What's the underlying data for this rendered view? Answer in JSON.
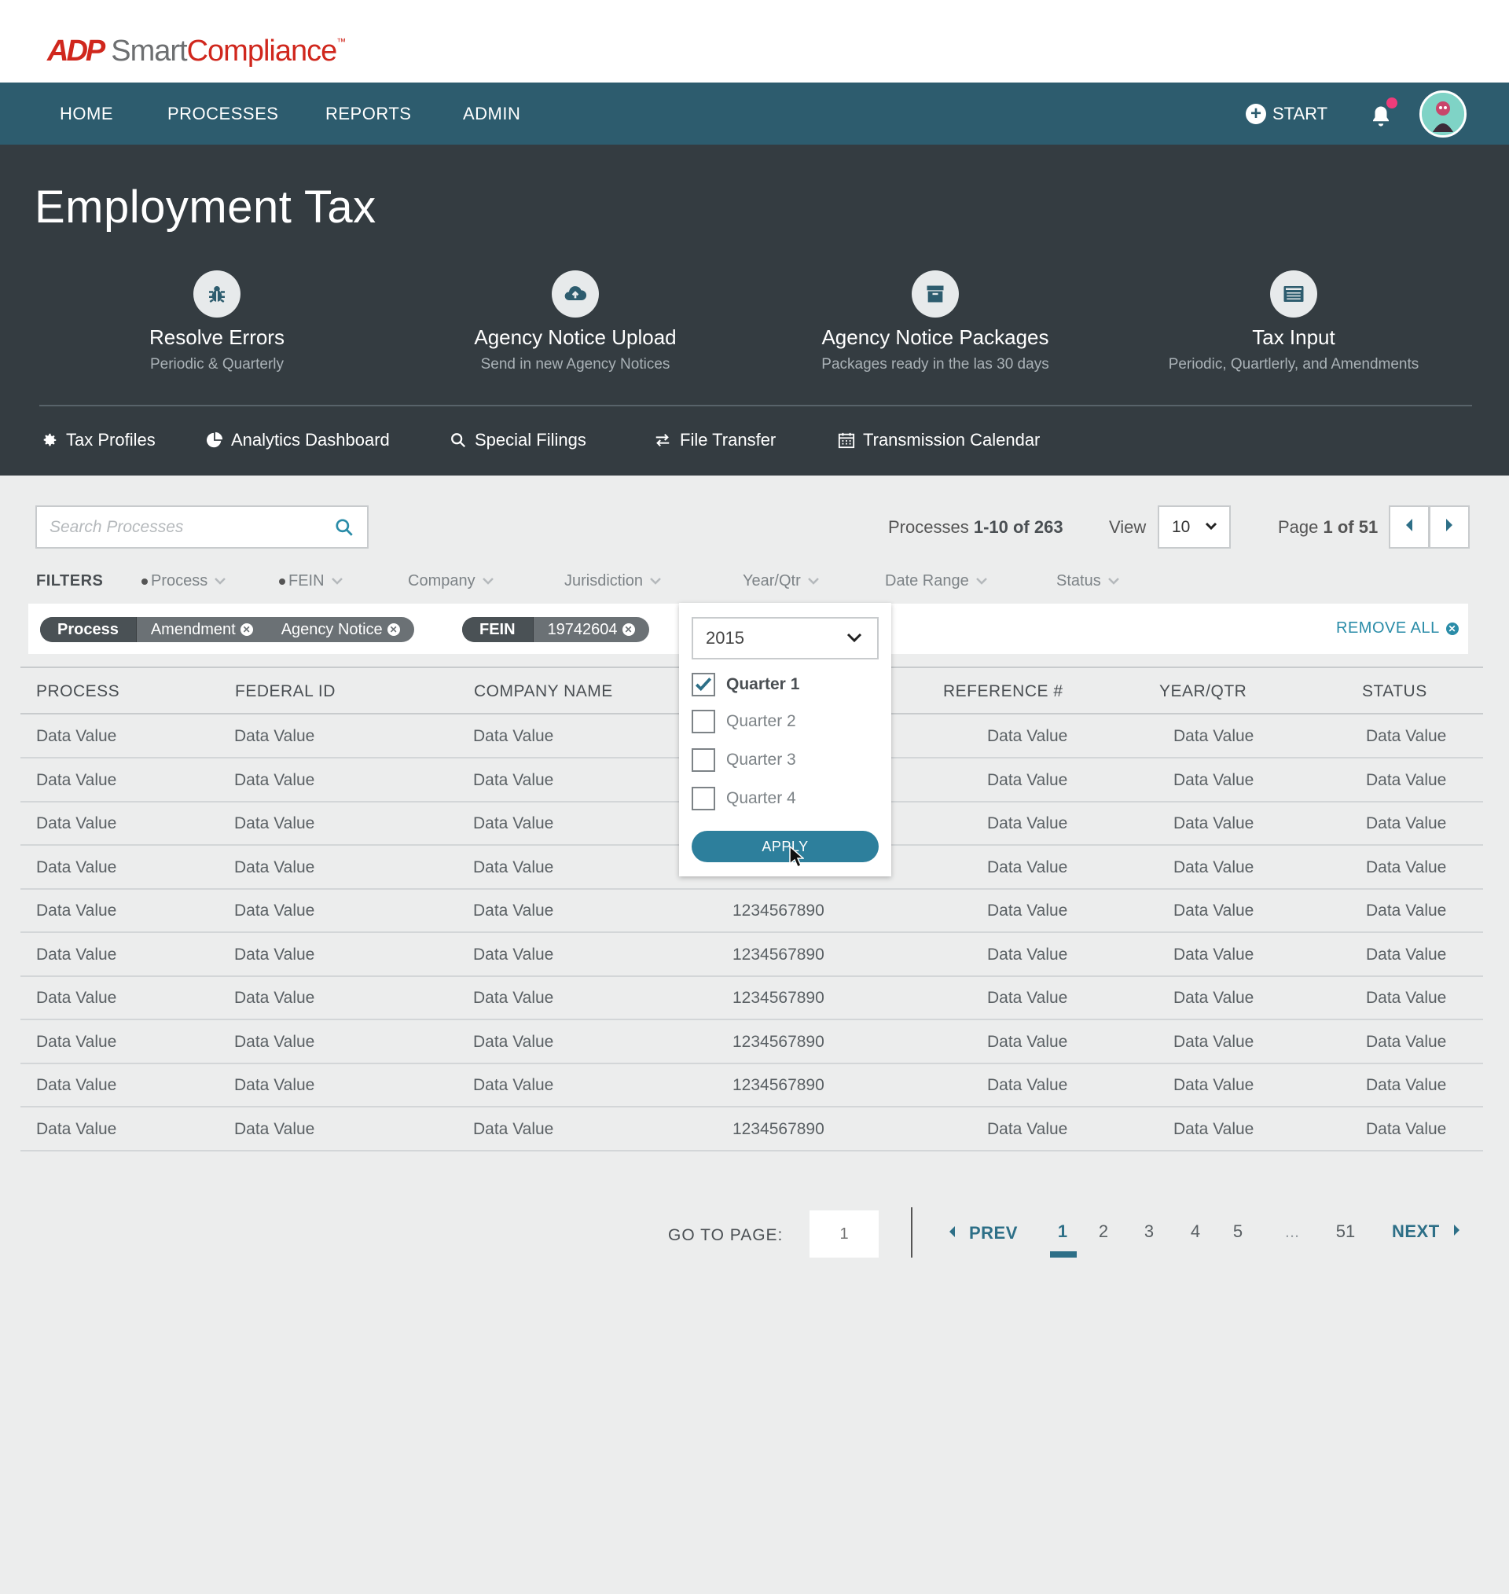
{
  "logo": {
    "mark": "ADP",
    "smart": "Smart",
    "compliance": "Compliance",
    "tm": "™"
  },
  "nav": {
    "items": [
      "HOME",
      "PROCESSES",
      "REPORTS",
      "ADMIN"
    ],
    "start_label": "START"
  },
  "hero": {
    "title": "Employment Tax",
    "tiles": [
      {
        "icon": "bug-icon",
        "title": "Resolve Errors",
        "subtitle": "Periodic & Quarterly"
      },
      {
        "icon": "cloud-upload-icon",
        "title": "Agency Notice Upload",
        "subtitle": "Send in new Agency Notices"
      },
      {
        "icon": "archive-box-icon",
        "title": "Agency Notice Packages",
        "subtitle": "Packages ready in the las 30 days"
      },
      {
        "icon": "list-card-icon",
        "title": "Tax Input",
        "subtitle": "Periodic, Quartlerly, and Amendments"
      }
    ],
    "links": [
      {
        "icon": "gear-icon",
        "label": "Tax Profiles"
      },
      {
        "icon": "pie-chart-icon",
        "label": "Analytics Dashboard"
      },
      {
        "icon": "search-icon",
        "label": "Special Filings"
      },
      {
        "icon": "transfer-arrows-icon",
        "label": "File Transfer"
      },
      {
        "icon": "calendar-icon",
        "label": "Transmission Calendar"
      }
    ]
  },
  "toolbar": {
    "search_placeholder": "Search Processes",
    "count_prefix": "Processes ",
    "count_range": "1-10 of 263",
    "view_label": "View",
    "view_value": "10",
    "page_prefix": "Page ",
    "page_value": "1 of 51"
  },
  "filters": {
    "label": "FILTERS",
    "items": [
      "Process",
      "FEIN",
      "Company",
      "Jurisdiction",
      "Year/Qtr",
      "Date Range",
      "Status"
    ]
  },
  "chips": {
    "groups": [
      {
        "head": "Process",
        "values": [
          "Amendment",
          "Agency Notice"
        ]
      },
      {
        "head": "FEIN",
        "values": [
          "19742604"
        ]
      }
    ],
    "remove_all": "REMOVE ALL"
  },
  "table": {
    "headers": [
      "PROCESS",
      "FEDERAL ID",
      "COMPANY NAME",
      "REFERENCE #",
      "YEAR/QTR",
      "STATUS"
    ],
    "rows": [
      [
        "Data Value",
        "Data Value",
        "Data Value",
        "",
        "Data Value",
        "Data Value",
        "Data Value"
      ],
      [
        "Data Value",
        "Data Value",
        "Data Value",
        "",
        "Data Value",
        "Data Value",
        "Data Value"
      ],
      [
        "Data Value",
        "Data Value",
        "Data Value",
        "",
        "Data Value",
        "Data Value",
        "Data Value"
      ],
      [
        "Data Value",
        "Data Value",
        "Data Value",
        "",
        "Data Value",
        "Data Value",
        "Data Value"
      ],
      [
        "Data Value",
        "Data Value",
        "Data Value",
        "1234567890",
        "Data Value",
        "Data Value",
        "Data Value"
      ],
      [
        "Data Value",
        "Data Value",
        "Data Value",
        "1234567890",
        "Data Value",
        "Data Value",
        "Data Value"
      ],
      [
        "Data Value",
        "Data Value",
        "Data Value",
        "1234567890",
        "Data Value",
        "Data Value",
        "Data Value"
      ],
      [
        "Data Value",
        "Data Value",
        "Data Value",
        "1234567890",
        "Data Value",
        "Data Value",
        "Data Value"
      ],
      [
        "Data Value",
        "Data Value",
        "Data Value",
        "1234567890",
        "Data Value",
        "Data Value",
        "Data Value"
      ],
      [
        "Data Value",
        "Data Value",
        "Data Value",
        "1234567890",
        "Data Value",
        "Data Value",
        "Data Value"
      ]
    ]
  },
  "dropdown": {
    "year": "2015",
    "quarters": [
      {
        "label": "Quarter 1",
        "checked": true
      },
      {
        "label": "Quarter 2",
        "checked": false
      },
      {
        "label": "Quarter 3",
        "checked": false
      },
      {
        "label": "Quarter 4",
        "checked": false
      }
    ],
    "apply_label": "APPLY"
  },
  "pagination": {
    "goto_label": "GO TO PAGE:",
    "goto_value": "1",
    "prev": "PREV",
    "next": "NEXT",
    "pages": [
      "1",
      "2",
      "3",
      "4",
      "5",
      "...",
      "51"
    ],
    "active": "1"
  },
  "colors": {
    "brand_red": "#d0271d",
    "nav_teal": "#2d5c6e",
    "hero_dark": "#343c41",
    "accent_link": "#2a8ca8"
  }
}
